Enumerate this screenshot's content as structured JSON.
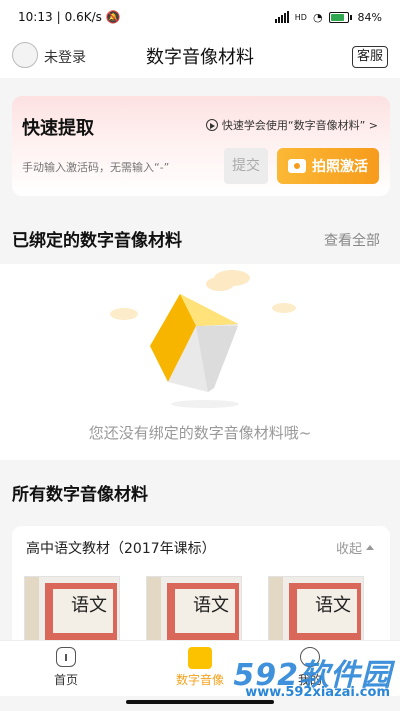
{
  "status_bar": {
    "time": "10:13",
    "speed": "0.6K/s",
    "battery": "84",
    "network": "HD"
  },
  "header": {
    "login_text": "未登录",
    "title": "数字音像材料",
    "service_label": "客服"
  },
  "quick": {
    "title": "快速提取",
    "help_text": "快速学会使用“数字音像材料” >",
    "input_placeholder": "手动输入激活码，无需输入“-”",
    "submit_label": "提交",
    "photo_label": "拍照激活"
  },
  "bound": {
    "title": "已绑定的数字音像材料",
    "view_all": "查看全部",
    "empty_text": "您还没有绑定的数字音像材料哦~"
  },
  "all": {
    "title": "所有数字音像材料",
    "category": "高中语文教材（2017年课标）",
    "collapse_label": "收起",
    "books": [
      {
        "char": "语文"
      },
      {
        "char": "语文"
      },
      {
        "char": "语文"
      }
    ]
  },
  "nav": {
    "items": [
      {
        "label": "首页"
      },
      {
        "label": "数字音像"
      },
      {
        "label": "我的"
      }
    ]
  },
  "watermark": {
    "brand": "592软件园",
    "url": "www.592xiazai.com"
  },
  "colors": {
    "accent": "#f79b1c",
    "brand_yellow": "#fcc200",
    "watermark": "#2a86d6"
  }
}
